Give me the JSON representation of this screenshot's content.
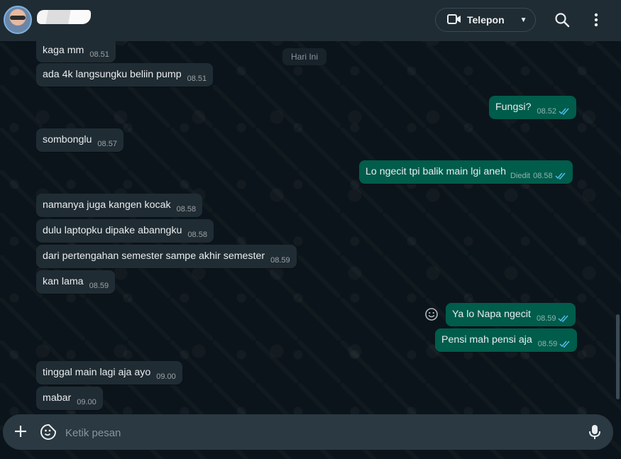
{
  "header": {
    "contact_name": "",
    "call_label": "Telepon"
  },
  "day_chip": "Hari Ini",
  "messages": [
    {
      "text": "kaga mm",
      "time": "08.51",
      "dir": "in"
    },
    {
      "text": "ada 4k langsungku beliin pump",
      "time": "08.51",
      "dir": "in"
    },
    {
      "text": "Fungsi?",
      "time": "08.52",
      "dir": "out"
    },
    {
      "text": "sombonglu",
      "time": "08.57",
      "dir": "in"
    },
    {
      "text": "Lo ngecit tpi balik main lgi aneh",
      "time": "08.58",
      "dir": "out",
      "edited": "Diedit"
    },
    {
      "text": "namanya juga kangen kocak",
      "time": "08.58",
      "dir": "in"
    },
    {
      "text": "dulu laptopku dipake abanngku",
      "time": "08.58",
      "dir": "in"
    },
    {
      "text": "dari pertengahan semester sampe akhir semester",
      "time": "08.59",
      "dir": "in"
    },
    {
      "text": "kan lama",
      "time": "08.59",
      "dir": "in"
    },
    {
      "text": "Ya lo Napa ngecit",
      "time": "08.59",
      "dir": "out"
    },
    {
      "text": "Pensi mah pensi aja",
      "time": "08.59",
      "dir": "out"
    },
    {
      "text": "tinggal main lagi aja ayo",
      "time": "09.00",
      "dir": "in"
    },
    {
      "text": "mabar",
      "time": "09.00",
      "dir": "in"
    }
  ],
  "composer": {
    "placeholder": "Ketik pesan"
  },
  "colors": {
    "incoming_bubble": "#202c33",
    "outgoing_bubble": "#005c4b",
    "tick_read": "#53bdeb"
  }
}
